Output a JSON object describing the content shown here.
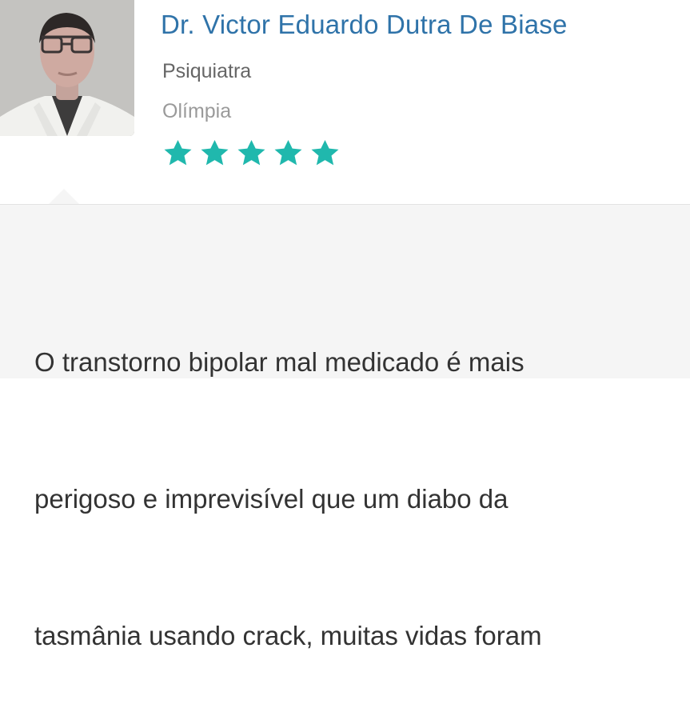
{
  "profile": {
    "avatar": "doctor-profile-photo",
    "name": "Dr. Victor Eduardo Dutra De Biase",
    "specialty": "Psiquiatra",
    "location": "Olímpia",
    "rating": 5,
    "rating_max": 5,
    "star_color": "#20b8ad"
  },
  "review": {
    "text_lines": [
      "O transtorno bipolar mal medicado é mais",
      "perigoso e imprevisível que um diabo da",
      "tasmânia usando crack, muitas vidas foram"
    ]
  },
  "colors": {
    "name": "#2f73a9",
    "bubble": "#f5f5f5"
  }
}
